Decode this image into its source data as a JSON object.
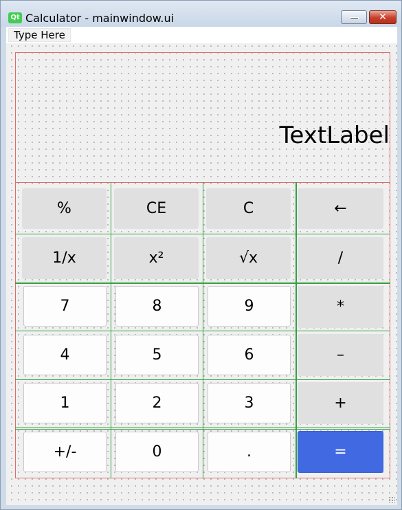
{
  "window": {
    "app_icon": "Qt",
    "title": "Calculator - mainwindow.ui",
    "minimize_glyph": "",
    "close_glyph": "✕"
  },
  "menu": {
    "placeholder": "Type Here"
  },
  "display": {
    "text": "TextLabel"
  },
  "keys": [
    [
      "%",
      "CE",
      "C",
      "←"
    ],
    [
      "1/x",
      "x²",
      "√x",
      "/"
    ],
    [
      "7",
      "8",
      "9",
      "*"
    ],
    [
      "4",
      "5",
      "6",
      "–"
    ],
    [
      "1",
      "2",
      "3",
      "+"
    ],
    [
      "+/-",
      "0",
      ".",
      "="
    ]
  ],
  "colors": {
    "equals_button": "#4169e1",
    "layout_frame": "#e06a6a",
    "grid_lines": "#2e9e3e",
    "function_key": "#e0e0e0",
    "digit_key": "#fdfdfd"
  }
}
